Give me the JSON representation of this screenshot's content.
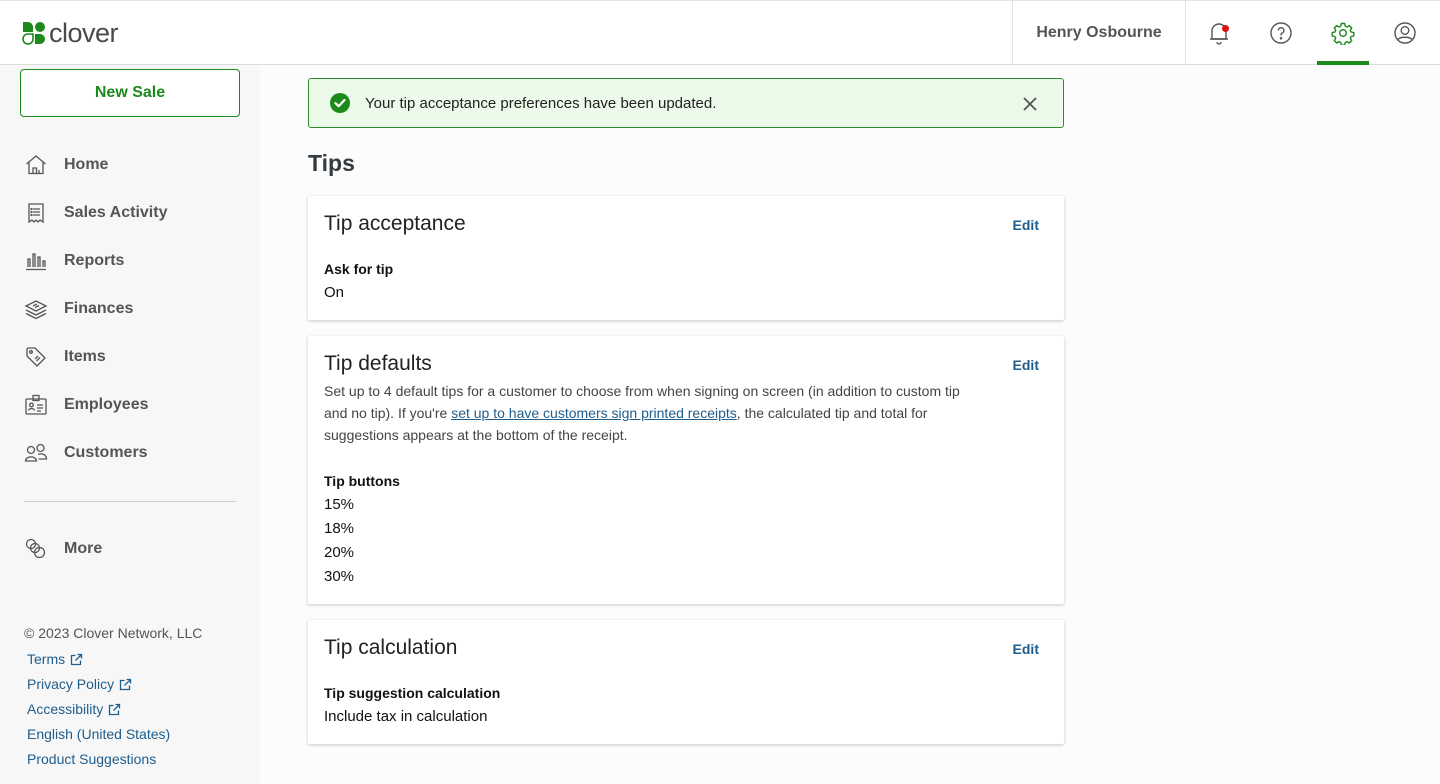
{
  "header": {
    "brand": "clover",
    "user_name": "Henry Osbourne",
    "icons": [
      "bell-icon",
      "help-icon",
      "gear-icon",
      "account-icon"
    ],
    "active_icon": "gear-icon",
    "colors": {
      "brand_green": "#1b8a1b",
      "notification_dot": "#e01010"
    }
  },
  "sidebar": {
    "new_sale_label": "New Sale",
    "items": [
      {
        "label": "Home",
        "icon": "home-icon"
      },
      {
        "label": "Sales Activity",
        "icon": "receipt-icon"
      },
      {
        "label": "Reports",
        "icon": "bar-chart-icon"
      },
      {
        "label": "Finances",
        "icon": "money-stack-icon"
      },
      {
        "label": "Items",
        "icon": "tag-icon"
      },
      {
        "label": "Employees",
        "icon": "id-badge-icon"
      },
      {
        "label": "Customers",
        "icon": "people-icon"
      }
    ],
    "more_label": "More",
    "copyright": "© 2023 Clover Network, LLC",
    "footer_links": [
      {
        "label": "Terms",
        "external": true
      },
      {
        "label": "Privacy Policy",
        "external": true
      },
      {
        "label": "Accessibility",
        "external": true
      },
      {
        "label": "English (United States)",
        "external": false
      },
      {
        "label": "Product Suggestions",
        "external": false
      }
    ]
  },
  "banner": {
    "message": "Your tip acceptance preferences have been updated.",
    "type": "success",
    "color": "#1b8a1b"
  },
  "page": {
    "title": "Tips",
    "cards": {
      "tip_acceptance": {
        "title": "Tip acceptance",
        "edit_label": "Edit",
        "field_label": "Ask for tip",
        "field_value": "On"
      },
      "tip_defaults": {
        "title": "Tip defaults",
        "edit_label": "Edit",
        "desc_before": "Set up to 4 default tips for a customer to choose from when signing on screen (in addition to custom tip and no tip). If you're ",
        "desc_link": "set up to have customers sign printed receipts",
        "desc_after": ", the calculated tip and total for suggestions appears at the bottom of the receipt.",
        "field_label": "Tip buttons",
        "values": [
          "15%",
          "18%",
          "20%",
          "30%"
        ]
      },
      "tip_calculation": {
        "title": "Tip calculation",
        "edit_label": "Edit",
        "field_label": "Tip suggestion calculation",
        "field_value": "Include tax in calculation"
      }
    }
  }
}
